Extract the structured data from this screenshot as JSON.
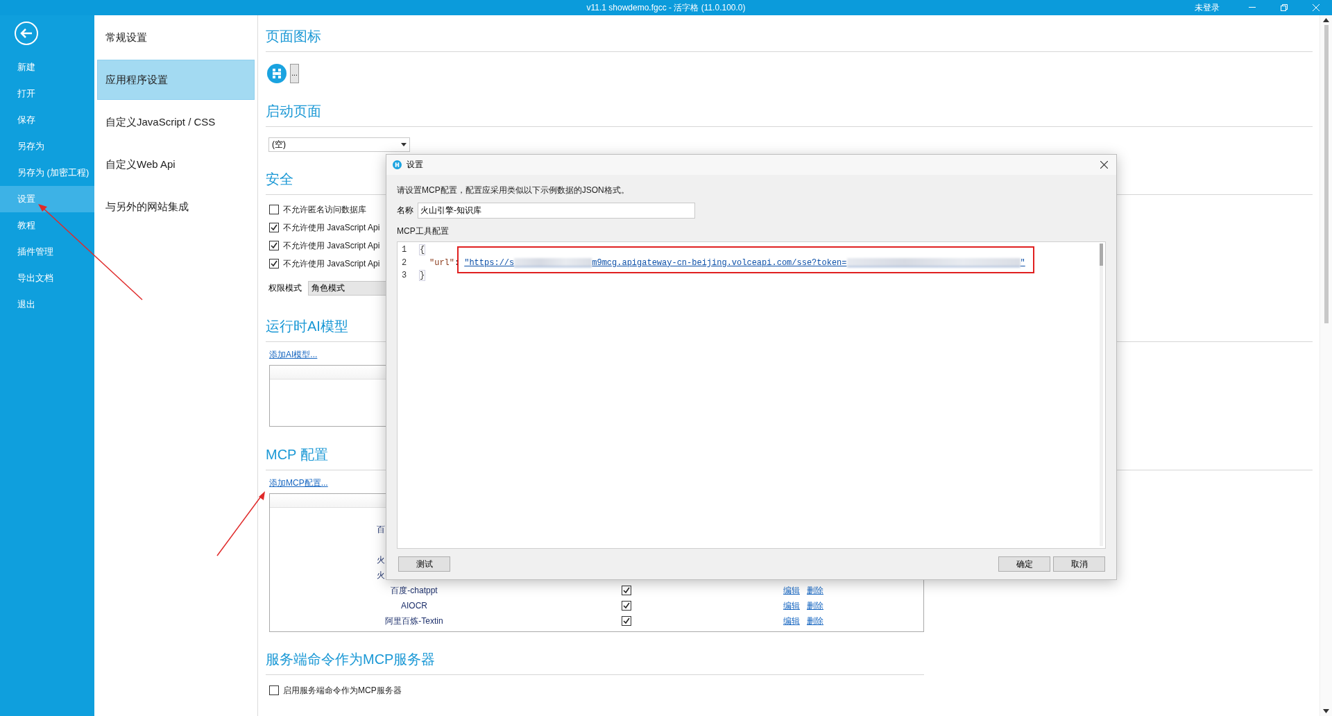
{
  "title_bar": {
    "title": "v11.1 showdemo.fgcc - 活字格 (11.0.100.0)",
    "user": "未登录"
  },
  "sidebar": {
    "items": [
      {
        "label": "新建",
        "selected": false
      },
      {
        "label": "打开",
        "selected": false
      },
      {
        "label": "保存",
        "selected": false
      },
      {
        "label": "另存为",
        "selected": false
      },
      {
        "label": "另存为 (加密工程)",
        "selected": false
      },
      {
        "label": "设置",
        "selected": true
      },
      {
        "label": "教程",
        "selected": false
      },
      {
        "label": "插件管理",
        "selected": false
      },
      {
        "label": "导出文档",
        "selected": false
      },
      {
        "label": "退出",
        "selected": false
      }
    ]
  },
  "settings_nav": {
    "items": [
      {
        "label": "常规设置",
        "selected": false
      },
      {
        "label": "应用程序设置",
        "selected": true
      },
      {
        "label": "自定义JavaScript / CSS",
        "selected": false
      },
      {
        "label": "自定义Web Api",
        "selected": false
      },
      {
        "label": "与另外的网站集成",
        "selected": false
      }
    ]
  },
  "page_icon": {
    "heading": "页面图标",
    "browse_button": "..."
  },
  "startup_page": {
    "heading": "启动页面",
    "value": "(空)"
  },
  "security": {
    "heading": "安全",
    "options": [
      {
        "label": "不允许匿名访问数据库",
        "checked": false
      },
      {
        "label": "不允许使用 JavaScript Api",
        "checked": true
      },
      {
        "label": "不允许使用 JavaScript Api",
        "checked": true
      },
      {
        "label": "不允许使用 JavaScript Api",
        "checked": true
      }
    ],
    "permission_label": "权限模式",
    "permission_value": "角色模式"
  },
  "ai_models": {
    "heading": "运行时AI模型",
    "add_link": "添加AI模型..."
  },
  "mcp": {
    "heading": "MCP 配置",
    "add_link": "添加MCP配置...",
    "rows": [
      {
        "kind": "covered",
        "name": "百"
      },
      {
        "kind": "covered"
      },
      {
        "kind": "covered",
        "name": "火"
      },
      {
        "kind": "covered",
        "name": "火"
      },
      {
        "kind": "full",
        "name": "百度-chatppt",
        "enabled": true,
        "edit": "编辑",
        "delete": "删除"
      },
      {
        "kind": "full",
        "name": "AIOCR",
        "enabled": true,
        "edit": "编辑",
        "delete": "删除"
      },
      {
        "kind": "full",
        "name": "阿里百炼-Textin",
        "enabled": true,
        "edit": "编辑",
        "delete": "删除"
      }
    ]
  },
  "mcp_server": {
    "heading": "服务端命令作为MCP服务器",
    "option": {
      "label": "启用服务端命令作为MCP服务器",
      "checked": false
    }
  },
  "dialog": {
    "title": "设置",
    "instruction": "请设置MCP配置，配置应采用类似以下示例数据的JSON格式。",
    "name_label": "名称",
    "name_value": "火山引擎-知识库",
    "config_label": "MCP工具配置",
    "lines": [
      {
        "number": "1",
        "segments": [
          {
            "kind": "bracket",
            "text": "{"
          }
        ]
      },
      {
        "number": "2",
        "segments": [
          {
            "kind": "key",
            "text": "\"url\""
          },
          {
            "kind": "colon",
            "text": ":"
          },
          {
            "kind": "string",
            "text": "\"https://s"
          },
          {
            "kind": "redacted"
          },
          {
            "kind": "string",
            "text": "m9mcg.apigateway-cn-beijing.volceapi.com/sse?token="
          },
          {
            "kind": "redacted"
          },
          {
            "kind": "string",
            "text": "\""
          }
        ]
      },
      {
        "number": "3",
        "segments": [
          {
            "kind": "bracket",
            "text": "}"
          }
        ]
      }
    ],
    "test_button": "测试",
    "ok_button": "确定",
    "cancel_button": "取消"
  }
}
